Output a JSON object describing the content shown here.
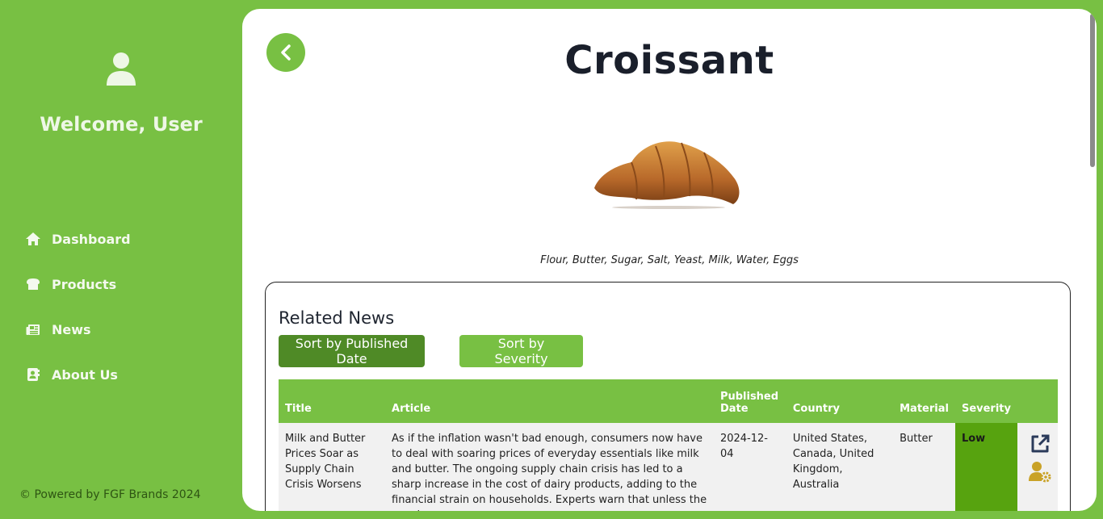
{
  "sidebar": {
    "welcome": "Welcome, User",
    "items": [
      {
        "label": "Dashboard",
        "icon": "home-icon"
      },
      {
        "label": "Products",
        "icon": "bread-icon"
      },
      {
        "label": "News",
        "icon": "newspaper-icon"
      },
      {
        "label": "About Us",
        "icon": "address-book-icon"
      }
    ],
    "powered": "© Powered by FGF Brands 2024"
  },
  "product": {
    "title": "Croissant",
    "ingredients": "Flour, Butter, Sugar, Salt, Yeast, Milk, Water, Eggs"
  },
  "news": {
    "heading": "Related News",
    "sort_date_label": "Sort by Published Date",
    "sort_severity_label": "Sort by Severity",
    "columns": [
      "Title",
      "Article",
      "Published Date",
      "Country",
      "Material",
      "Severity"
    ],
    "rows": [
      {
        "title": "Milk and Butter Prices Soar as Supply Chain Crisis Worsens",
        "article": "As if the inflation wasn't bad enough, consumers now have to deal with soaring prices of everyday essentials like milk and butter. The ongoing supply chain crisis has led to a sharp increase in the cost of dairy products, adding to the financial strain on households. Experts warn that unless the supply",
        "date": "2024-12-04",
        "country": "United States, Canada, United Kingdom, Australia",
        "material": "Butter",
        "severity": "Low"
      }
    ]
  },
  "colors": {
    "brand_green": "#78c043",
    "dark_green": "#4f8a26",
    "severity_low": "#57a30f"
  }
}
